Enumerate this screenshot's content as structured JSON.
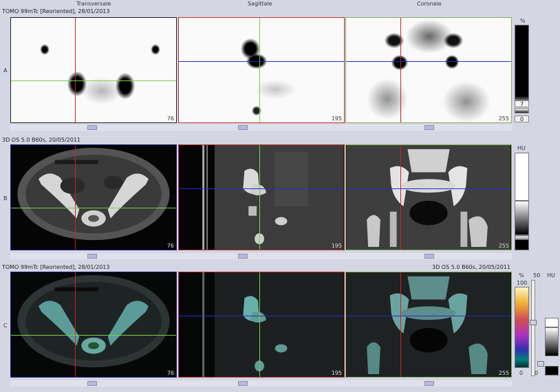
{
  "columns": [
    "Transversale",
    "Sagittale",
    "Coronale"
  ],
  "rows": [
    {
      "letter": "A",
      "title": "TOMO 99mTc [Reoriented], 28/01/2013",
      "title_right": "",
      "slices": [
        "76",
        "195",
        "255"
      ]
    },
    {
      "letter": "B",
      "title": "3D  OS  5.0  B60s, 20/05/2011",
      "title_right": "",
      "slices": [
        "76",
        "195",
        "255"
      ]
    },
    {
      "letter": "C",
      "title": "TOMO 99mTc [Reoriented], 28/01/2013",
      "title_right": "3D  OS  5.0  B60s, 20/05/2011",
      "slices": [
        "76",
        "195",
        "255"
      ]
    }
  ],
  "scale_a": {
    "unit": "%",
    "upper_value": "7",
    "lower_value": "0"
  },
  "scale_b": {
    "unit": "HU"
  },
  "scale_c": {
    "unit_pct": "%",
    "pct_max": "100",
    "pct_min": "0",
    "window_value": "50",
    "unit_hu": "HU",
    "hu_min": "0"
  },
  "colors": {
    "crosshair_red": "#d02020",
    "crosshair_green": "#7ad040",
    "crosshair_blue": "#2030d0",
    "frame_transverse": "#1c1c8c",
    "frame_sagittal": "#c03030",
    "frame_coronal": "#80b050",
    "background": "#d4d6e4"
  }
}
